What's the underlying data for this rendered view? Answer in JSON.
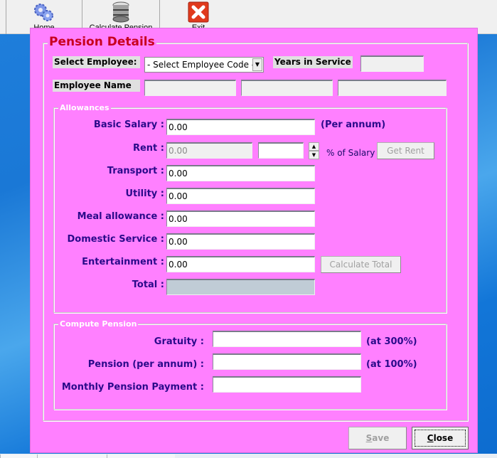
{
  "toolbar": {
    "items": [
      {
        "label": "Home",
        "icon": "gears-icon"
      },
      {
        "label": "Calculate Pension",
        "icon": "database-icon"
      },
      {
        "label": "Exit",
        "icon": "red-x-icon"
      }
    ]
  },
  "dialog": {
    "title": "Pension Details",
    "select_employee_label": "Select Employee:",
    "employee_code_selected": "- Select Employee Code -",
    "years_in_service_label": "Years in Service",
    "years_in_service_value": "",
    "employee_name_label": "Employee Name",
    "employee_name_values": [
      "",
      "",
      ""
    ],
    "allowances": {
      "title": "Allowances",
      "basic_salary_label": "Basic Salary :",
      "basic_salary_value": "0.00",
      "per_annum_label": "(Per annum)",
      "rent_label": "Rent :",
      "rent_value": "0.00",
      "rent_percent_value": "",
      "percent_of_salary_label": "% of Salary",
      "get_rent_button": "Get Rent",
      "transport_label": "Transport :",
      "transport_value": "0.00",
      "utility_label": "Utility :",
      "utility_value": "0.00",
      "meal_label": "Meal allowance :",
      "meal_value": "0.00",
      "domestic_label": "Domestic Service :",
      "domestic_value": "0.00",
      "entertainment_label": "Entertainment :",
      "entertainment_value": "0.00",
      "calculate_total_button": "Calculate Total",
      "total_label": "Total :",
      "total_value": ""
    },
    "compute": {
      "title": "Compute Pension",
      "gratuity_label": "Gratuity :",
      "gratuity_value": "",
      "gratuity_note": "(at 300%)",
      "pension_label": "Pension (per annum) :",
      "pension_value": "",
      "pension_note": "(at 100%)",
      "monthly_label": "Monthly Pension Payment :",
      "monthly_value": ""
    },
    "save_button": {
      "mnemonic": "S",
      "rest": "ave"
    },
    "close_button": {
      "mnemonic": "C",
      "rest": "lose"
    }
  },
  "colors": {
    "dialog_bg": "#ff80ff",
    "title_red": "#c8001e",
    "label_navy": "#2a0a8a"
  }
}
